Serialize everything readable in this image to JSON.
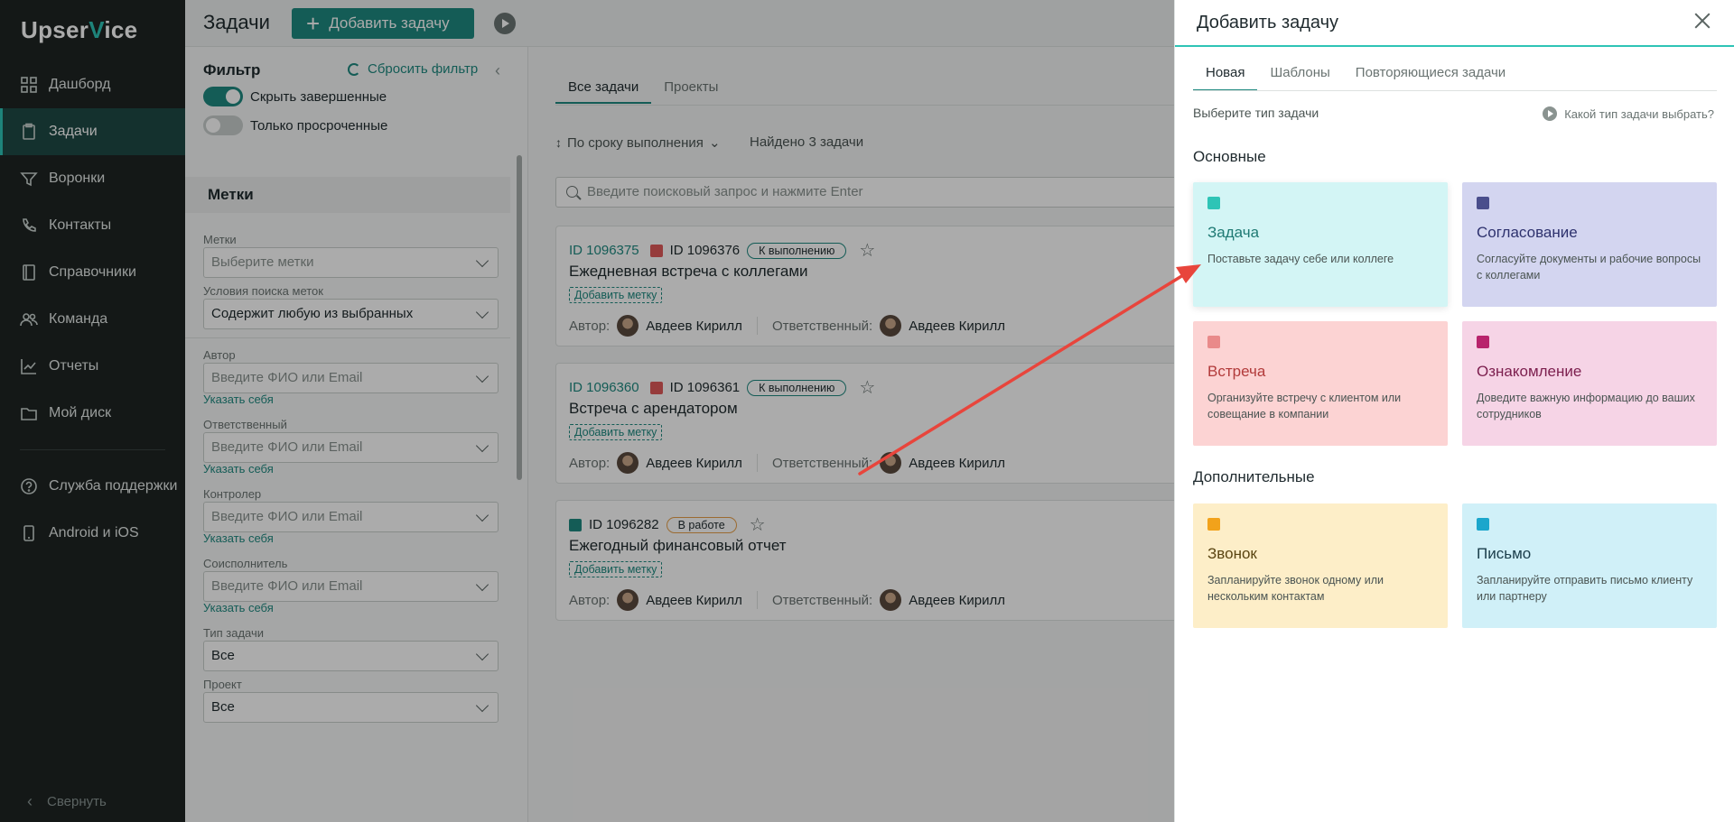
{
  "app": {
    "logo_text_a": "Upser",
    "logo_text_b": "V",
    "logo_text_c": "ice"
  },
  "sidebar": {
    "items": [
      {
        "label": "Дашборд",
        "icon": "grid-icon"
      },
      {
        "label": "Задачи",
        "icon": "clipboard-icon",
        "active": true
      },
      {
        "label": "Воронки",
        "icon": "funnel-icon"
      },
      {
        "label": "Контакты",
        "icon": "phone-icon"
      },
      {
        "label": "Справочники",
        "icon": "book-icon"
      },
      {
        "label": "Команда",
        "icon": "team-icon"
      },
      {
        "label": "Отчеты",
        "icon": "chart-icon"
      },
      {
        "label": "Мой диск",
        "icon": "folder-icon"
      }
    ],
    "bottom_items": [
      {
        "label": "Служба поддержки",
        "icon": "help-icon"
      },
      {
        "label": "Android и iOS",
        "icon": "mobile-icon"
      }
    ],
    "collapse_label": "Свернуть"
  },
  "header": {
    "title": "Задачи",
    "add_button": "Добавить задачу"
  },
  "filter": {
    "title": "Фильтр",
    "reset": "Сбросить фильтр",
    "toggle_hide_completed": "Скрыть завершенные",
    "toggle_only_overdue": "Только просроченные",
    "tags_section": "Метки",
    "tags_label": "Метки",
    "tags_placeholder": "Выберите метки",
    "tag_condition_label": "Условия поиска меток",
    "tag_condition_value": "Содержит любую из выбранных",
    "author_label": "Автор",
    "author_placeholder": "Введите ФИО или Email",
    "responsible_label": "Ответственный",
    "responsible_placeholder": "Введите ФИО или Email",
    "controller_label": "Контролер",
    "controller_placeholder": "Введите ФИО или Email",
    "coexecutor_label": "Соисполнитель",
    "coexecutor_placeholder": "Введите ФИО или Email",
    "set_self": "Указать себя",
    "task_type_label": "Тип задачи",
    "task_type_value": "Все",
    "project_label": "Проект",
    "project_value": "Все"
  },
  "main": {
    "tabs": [
      "Все задачи",
      "Проекты"
    ],
    "sort_label": "По сроку выполнения",
    "found_label": "Найдено 3 задачи",
    "search_placeholder": "Введите поисковый запрос и нажмите Enter",
    "add_tag": "Добавить метку",
    "author_label": "Автор:",
    "responsible_label": "Ответственный:",
    "tasks": [
      {
        "id1": "ID 1096375",
        "id2": "ID 1096376",
        "status": "К выполнению",
        "title": "Ежедневная встреча с коллегами",
        "author": "Авдеев Кирилл",
        "responsible": "Авдеев Кирилл"
      },
      {
        "id1": "ID 1096360",
        "id2": "ID 1096361",
        "status": "К выполнению",
        "title": "Встреча с арендатором",
        "author": "Авдеев Кирилл",
        "responsible": "Авдеев Кирилл"
      },
      {
        "id1": "",
        "id2": "ID 1096282",
        "status": "В работе",
        "title": "Ежегодный финансовый отчет",
        "author": "Авдеев Кирилл",
        "responsible": "Авдеев Кирилл"
      }
    ]
  },
  "dialog": {
    "title": "Добавить задачу",
    "tabs": [
      "Новая",
      "Шаблоны",
      "Повторяющиеся задачи"
    ],
    "choose_type": "Выберите тип задачи",
    "help_link": "Какой тип задачи выбрать?",
    "group_main": "Основные",
    "group_extra": "Дополнительные",
    "types": [
      {
        "name": "Задача",
        "desc": "Поставьте задачу себе или коллеге",
        "icon": "task-list-icon"
      },
      {
        "name": "Согласование",
        "desc": "Согласуйте документы и рабочие вопросы с коллегами",
        "icon": "approval-icon"
      },
      {
        "name": "Встреча",
        "desc": "Организуйте встречу с клиентом или совещание в компании",
        "icon": "clock-icon"
      },
      {
        "name": "Ознакомление",
        "desc": "Доведите важную информацию до ваших сотрудников",
        "icon": "eye-icon"
      },
      {
        "name": "Звонок",
        "desc": "Запланируйте звонок одному или нескольким контактам",
        "icon": "phone-icon"
      },
      {
        "name": "Письмо",
        "desc": "Запланируйте отправить письмо клиенту или партнеру",
        "icon": "mail-icon"
      }
    ]
  },
  "colors": {
    "accent": "#1f8a80",
    "sidebar_bg": "#1e2423",
    "annotation_arrow": "#e8453c"
  }
}
